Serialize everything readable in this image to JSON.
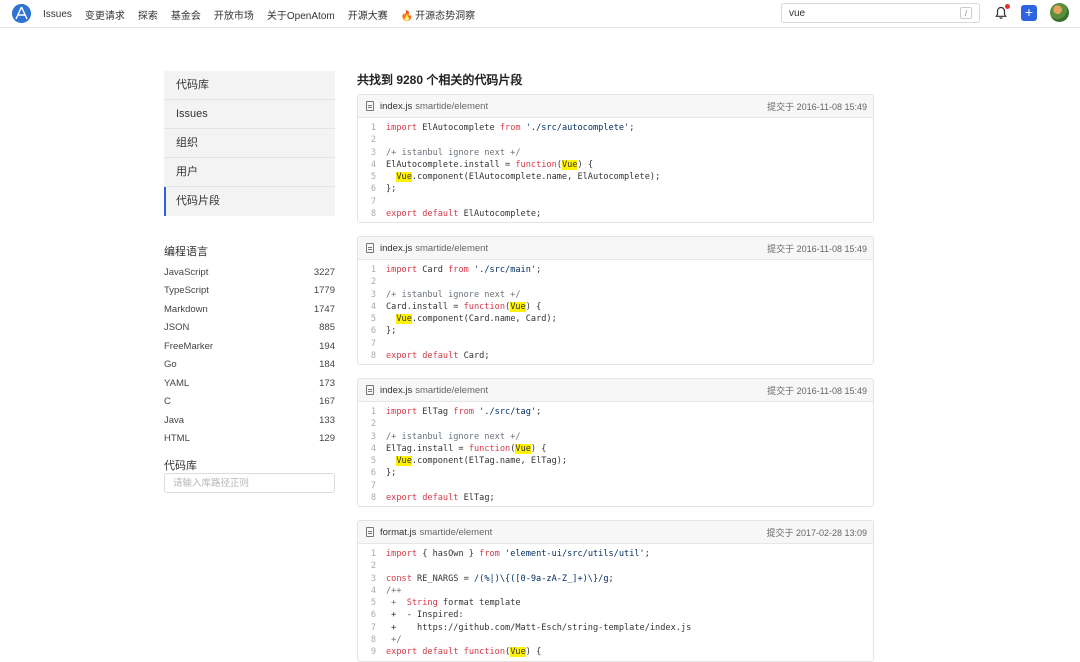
{
  "nav": {
    "items": [
      "Issues",
      "变更请求",
      "探索",
      "基金会",
      "开放市场",
      "关于OpenAtom",
      "开源大赛",
      "开源态势洞察"
    ],
    "search_value": "vue",
    "search_shortcut": "/"
  },
  "sidebar": {
    "menu": [
      "代码库",
      "Issues",
      "组织",
      "用户",
      "代码片段"
    ],
    "active": "代码片段",
    "lang_title": "编程语言",
    "languages": [
      {
        "name": "JavaScript",
        "count": "3227"
      },
      {
        "name": "TypeScript",
        "count": "1779"
      },
      {
        "name": "Markdown",
        "count": "1747"
      },
      {
        "name": "JSON",
        "count": "885"
      },
      {
        "name": "FreeMarker",
        "count": "194"
      },
      {
        "name": "Go",
        "count": "184"
      },
      {
        "name": "YAML",
        "count": "173"
      },
      {
        "name": "C",
        "count": "167"
      },
      {
        "name": "Java",
        "count": "133"
      },
      {
        "name": "HTML",
        "count": "129"
      }
    ],
    "repo_title": "代码库",
    "repo_placeholder": "请输入库路径正则"
  },
  "results": {
    "title": "共找到 9280 个相关的代码片段",
    "cards": [
      {
        "file": "index.js",
        "repo": "smartide/element",
        "commit": "提交于 2016-11-08 15:49",
        "lines": [
          {
            "n": "1",
            "parts": [
              {
                "t": "import",
                "c": "kw"
              },
              {
                "t": " ElAutocomplete "
              },
              {
                "t": "from",
                "c": "kw"
              },
              {
                "t": " "
              },
              {
                "t": "'./src/autocomplete'",
                "c": "str"
              },
              {
                "t": ";"
              }
            ]
          },
          {
            "n": "2",
            "parts": []
          },
          {
            "n": "3",
            "parts": [
              {
                "t": "/+ istanbul ignore next +/",
                "c": "cm"
              }
            ]
          },
          {
            "n": "4",
            "parts": [
              {
                "t": "ElAutocomplete.install = "
              },
              {
                "t": "function",
                "c": "kw"
              },
              {
                "t": "("
              },
              {
                "t": "Vue",
                "c": "hl"
              },
              {
                "t": ") {"
              }
            ]
          },
          {
            "n": "5",
            "parts": [
              {
                "t": "  "
              },
              {
                "t": "Vue",
                "c": "hl"
              },
              {
                "t": ".component(ElAutocomplete.name, ElAutocomplete);"
              }
            ]
          },
          {
            "n": "6",
            "parts": [
              {
                "t": "};"
              }
            ]
          },
          {
            "n": "7",
            "parts": []
          },
          {
            "n": "8",
            "parts": [
              {
                "t": "export",
                "c": "kw"
              },
              {
                "t": " "
              },
              {
                "t": "default",
                "c": "kw"
              },
              {
                "t": " ElAutocomplete;"
              }
            ]
          }
        ]
      },
      {
        "file": "index.js",
        "repo": "smartide/element",
        "commit": "提交于 2016-11-08 15:49",
        "lines": [
          {
            "n": "1",
            "parts": [
              {
                "t": "import",
                "c": "kw"
              },
              {
                "t": " Card "
              },
              {
                "t": "from",
                "c": "kw"
              },
              {
                "t": " "
              },
              {
                "t": "'./src/main'",
                "c": "str"
              },
              {
                "t": ";"
              }
            ]
          },
          {
            "n": "2",
            "parts": []
          },
          {
            "n": "3",
            "parts": [
              {
                "t": "/+ istanbul ignore next +/",
                "c": "cm"
              }
            ]
          },
          {
            "n": "4",
            "parts": [
              {
                "t": "Card.install = "
              },
              {
                "t": "function",
                "c": "kw"
              },
              {
                "t": "("
              },
              {
                "t": "Vue",
                "c": "hl"
              },
              {
                "t": ") {"
              }
            ]
          },
          {
            "n": "5",
            "parts": [
              {
                "t": "  "
              },
              {
                "t": "Vue",
                "c": "hl"
              },
              {
                "t": ".component(Card.name, Card);"
              }
            ]
          },
          {
            "n": "6",
            "parts": [
              {
                "t": "};"
              }
            ]
          },
          {
            "n": "7",
            "parts": []
          },
          {
            "n": "8",
            "parts": [
              {
                "t": "export",
                "c": "kw"
              },
              {
                "t": " "
              },
              {
                "t": "default",
                "c": "kw"
              },
              {
                "t": " Card;"
              }
            ]
          }
        ]
      },
      {
        "file": "index.js",
        "repo": "smartide/element",
        "commit": "提交于 2016-11-08 15:49",
        "lines": [
          {
            "n": "1",
            "parts": [
              {
                "t": "import",
                "c": "kw"
              },
              {
                "t": " ElTag "
              },
              {
                "t": "from",
                "c": "kw"
              },
              {
                "t": " "
              },
              {
                "t": "'./src/tag'",
                "c": "str"
              },
              {
                "t": ";"
              }
            ]
          },
          {
            "n": "2",
            "parts": []
          },
          {
            "n": "3",
            "parts": [
              {
                "t": "/+ istanbul ignore next +/",
                "c": "cm"
              }
            ]
          },
          {
            "n": "4",
            "parts": [
              {
                "t": "ElTag.install = "
              },
              {
                "t": "function",
                "c": "kw"
              },
              {
                "t": "("
              },
              {
                "t": "Vue",
                "c": "hl"
              },
              {
                "t": ") {"
              }
            ]
          },
          {
            "n": "5",
            "parts": [
              {
                "t": "  "
              },
              {
                "t": "Vue",
                "c": "hl"
              },
              {
                "t": ".component(ElTag.name, ElTag);"
              }
            ]
          },
          {
            "n": "6",
            "parts": [
              {
                "t": "};"
              }
            ]
          },
          {
            "n": "7",
            "parts": []
          },
          {
            "n": "8",
            "parts": [
              {
                "t": "export",
                "c": "kw"
              },
              {
                "t": " "
              },
              {
                "t": "default",
                "c": "kw"
              },
              {
                "t": " ElTag;"
              }
            ]
          }
        ]
      },
      {
        "file": "format.js",
        "repo": "smartide/element",
        "commit": "提交于 2017-02-28 13:09",
        "lines": [
          {
            "n": "1",
            "parts": [
              {
                "t": "import",
                "c": "kw"
              },
              {
                "t": " { hasOwn } "
              },
              {
                "t": "from",
                "c": "kw"
              },
              {
                "t": " "
              },
              {
                "t": "'element-ui/src/utils/util'",
                "c": "str"
              },
              {
                "t": ";"
              }
            ]
          },
          {
            "n": "2",
            "parts": []
          },
          {
            "n": "3",
            "parts": [
              {
                "t": "const",
                "c": "kw"
              },
              {
                "t": " RE_NARGS = "
              },
              {
                "t": "/(%|)\\{([0-9a-zA-Z_]+)\\}/g",
                "c": "str"
              },
              {
                "t": ";"
              }
            ]
          },
          {
            "n": "4",
            "parts": [
              {
                "t": "/++",
                "c": "cm"
              }
            ]
          },
          {
            "n": "5",
            "parts": [
              {
                "t": " +  ",
                "c": "cm"
              },
              {
                "t": "String",
                "c": "kw"
              },
              {
                "t": " format template"
              }
            ]
          },
          {
            "n": "6",
            "parts": [
              {
                "t": " +  - Inspired:"
              }
            ]
          },
          {
            "n": "7",
            "parts": [
              {
                "t": " +    https://github.com/Matt-Esch/string-template/index.js"
              }
            ]
          },
          {
            "n": "8",
            "parts": [
              {
                "t": " +/",
                "c": "cm"
              }
            ]
          },
          {
            "n": "9",
            "parts": [
              {
                "t": "export",
                "c": "kw"
              },
              {
                "t": " "
              },
              {
                "t": "default",
                "c": "kw"
              },
              {
                "t": " "
              },
              {
                "t": "function",
                "c": "kw"
              },
              {
                "t": "("
              },
              {
                "t": "Vue",
                "c": "hl"
              },
              {
                "t": ") {"
              }
            ]
          }
        ]
      }
    ]
  }
}
